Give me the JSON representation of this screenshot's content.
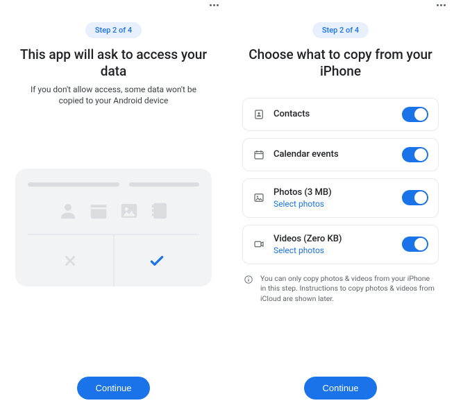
{
  "left": {
    "step_badge": "Step 2 of 4",
    "title": "This app will ask to access your data",
    "subtitle": "If you don't allow access, some data won't be copied to your Android device",
    "continue_label": "Continue"
  },
  "right": {
    "step_badge": "Step 2 of 4",
    "title": "Choose what to copy from your iPhone",
    "items": [
      {
        "label": "Contacts",
        "sublabel": "",
        "toggled": true
      },
      {
        "label": "Calendar events",
        "sublabel": "",
        "toggled": true
      },
      {
        "label": "Photos (3 MB)",
        "sublabel": "Select photos",
        "toggled": true
      },
      {
        "label": "Videos (Zero KB)",
        "sublabel": "Select photos",
        "toggled": true
      }
    ],
    "note": "You can only copy photos & videos from your iPhone in this step. Instructions to copy photos & videos from iCloud are shown later.",
    "continue_label": "Continue"
  },
  "colors": {
    "accent": "#1a73e8"
  }
}
